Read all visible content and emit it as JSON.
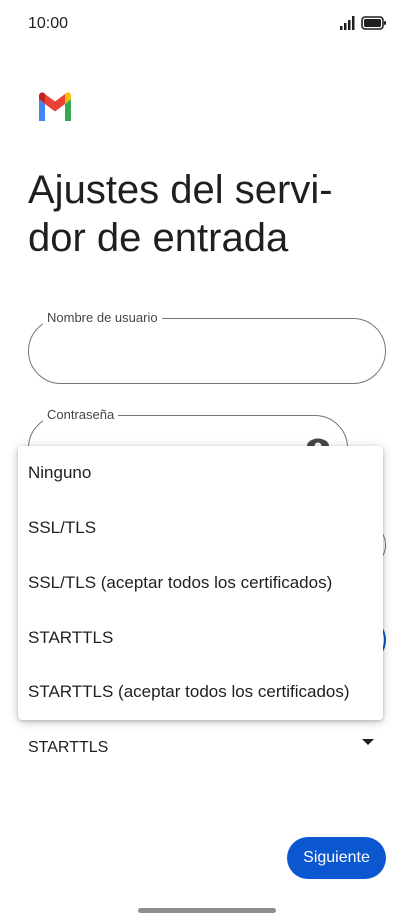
{
  "status_bar": {
    "time": "10:00"
  },
  "title": "Ajustes del servi-\ndor de entrada",
  "fields": {
    "username": {
      "label": "Nombre de usuario",
      "value": ""
    },
    "password": {
      "label": "Contraseña",
      "value": ""
    }
  },
  "security": {
    "selected": "STARTTLS",
    "options": [
      "Ninguno",
      "SSL/TLS",
      "SSL/TLS (aceptar todos los certificados)",
      "STARTTLS",
      "STARTTLS (aceptar todos los certificados)"
    ]
  },
  "actions": {
    "next_label": "Siguiente"
  },
  "colors": {
    "accent": "#0b57d0",
    "outline": "#747775",
    "text": "#1f1f1f"
  },
  "icons": {
    "logo": "gmail-logo",
    "signal": "signal-icon",
    "battery": "battery-icon",
    "password_toggle": "eye-icon",
    "dropdown": "dropdown-arrow-icon"
  }
}
